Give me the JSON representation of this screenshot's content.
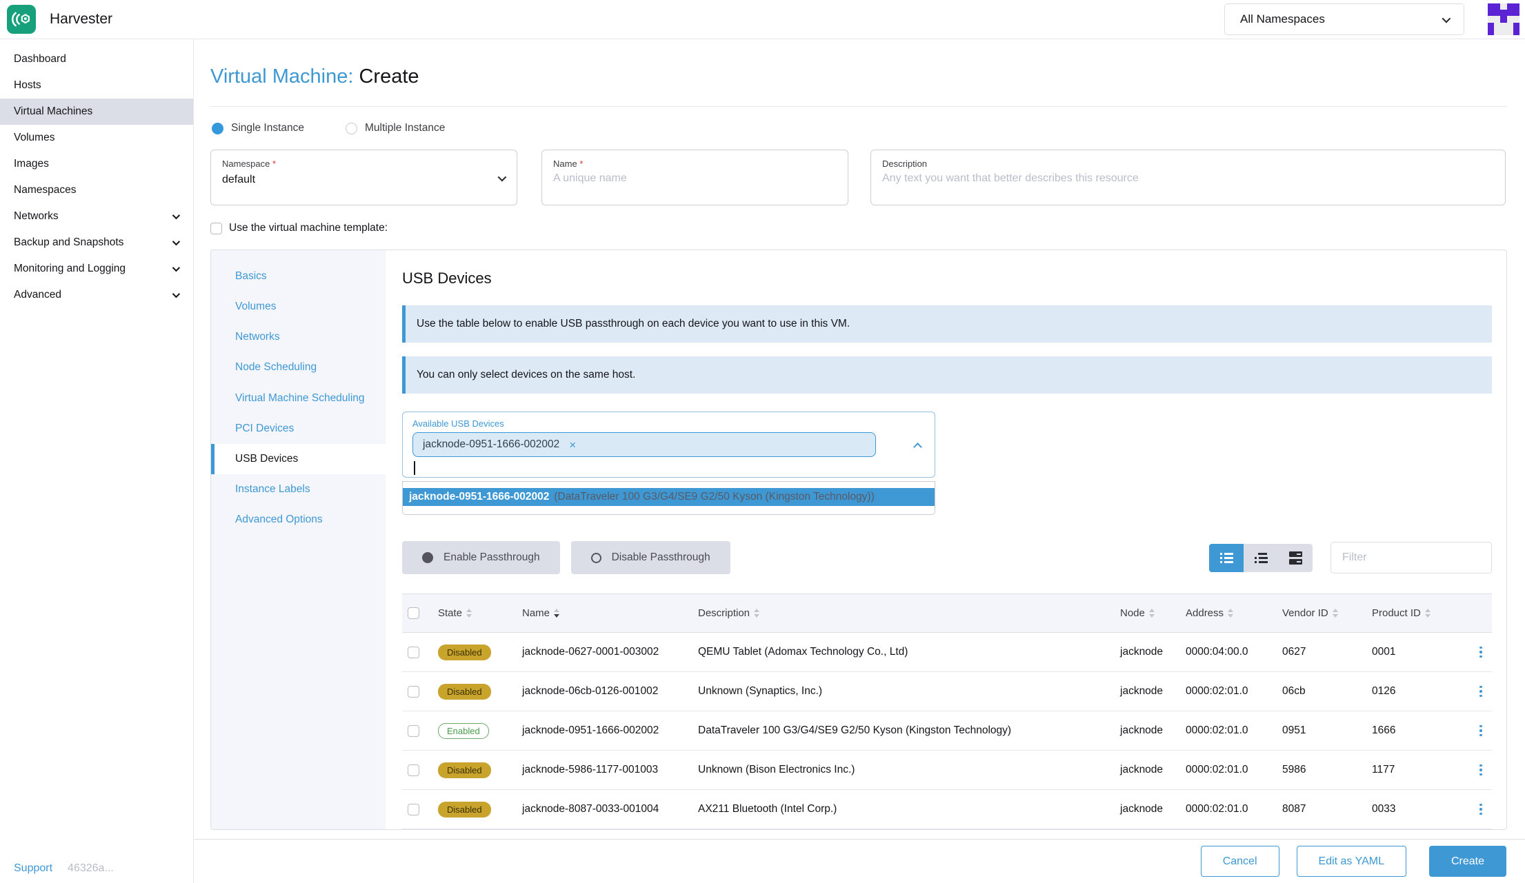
{
  "colors": {
    "primary": "#3d98d3",
    "banner_bg": "#ddeaf5",
    "warning_badge": "#c9a42d",
    "success_green": "#4b9a4b",
    "sidebar_selected": "#dcdee7",
    "avatar_purple": "#5c23d4",
    "logo_green": "#16a17c"
  },
  "header": {
    "brand": "Harvester",
    "namespace_filter": "All Namespaces",
    "avatar_pattern": [
      "11011",
      "11111",
      "00100",
      "10001",
      "10001"
    ]
  },
  "sidebar": {
    "items": [
      {
        "label": "Dashboard"
      },
      {
        "label": "Hosts"
      },
      {
        "label": "Virtual Machines"
      },
      {
        "label": "Volumes"
      },
      {
        "label": "Images"
      },
      {
        "label": "Namespaces"
      },
      {
        "label": "Networks"
      },
      {
        "label": "Backup and Snapshots"
      },
      {
        "label": "Monitoring and Logging"
      },
      {
        "label": "Advanced"
      }
    ],
    "active_item": "Virtual Machines",
    "support_label": "Support",
    "version": "46326a..."
  },
  "page": {
    "title_resource": "Virtual Machine:",
    "title_action": "Create",
    "instance_modes": {
      "single": "Single Instance",
      "multiple": "Multiple Instance",
      "selected": "Single Instance"
    }
  },
  "form": {
    "namespace": {
      "label": "Namespace",
      "required_mark": "*",
      "value": "default"
    },
    "name": {
      "label": "Name",
      "required_mark": "*",
      "placeholder": "A unique name"
    },
    "description": {
      "label": "Description",
      "placeholder": "Any text you want that better describes this resource"
    },
    "template_checkbox_label": "Use the virtual machine template:"
  },
  "tabs": {
    "items": [
      {
        "label": "Basics"
      },
      {
        "label": "Volumes"
      },
      {
        "label": "Networks"
      },
      {
        "label": "Node Scheduling"
      },
      {
        "label": "Virtual Machine Scheduling"
      },
      {
        "label": "PCI Devices"
      },
      {
        "label": "USB Devices"
      },
      {
        "label": "Instance Labels"
      },
      {
        "label": "Advanced Options"
      }
    ],
    "active_tab": "USB Devices"
  },
  "usb": {
    "heading": "USB Devices",
    "banners": [
      "Use the table below to enable USB passthrough on each device you want to use in this VM.",
      "You can only select devices on the same host."
    ],
    "picker": {
      "label": "Available USB Devices",
      "selected_tag": "jacknode-0951-1666-002002",
      "remove_mark": "×",
      "option": {
        "name": "jacknode-0951-1666-002002",
        "description": "(DataTraveler 100 G3/G4/SE9 G2/50 Kyson (Kingston Technology))"
      }
    },
    "actions": {
      "enable": "Enable Passthrough",
      "disable": "Disable Passthrough"
    },
    "filter_placeholder": "Filter",
    "table": {
      "columns": [
        "State",
        "Name",
        "Description",
        "Node",
        "Address",
        "Vendor ID",
        "Product ID"
      ],
      "sorted_column": "Name",
      "rows": [
        {
          "state": "Disabled",
          "name": "jacknode-0627-0001-003002",
          "description": "QEMU Tablet (Adomax Technology Co., Ltd)",
          "node": "jacknode",
          "address": "0000:04:00.0",
          "vendor_id": "0627",
          "product_id": "0001"
        },
        {
          "state": "Disabled",
          "name": "jacknode-06cb-0126-001002",
          "description": "Unknown (Synaptics, Inc.)",
          "node": "jacknode",
          "address": "0000:02:01.0",
          "vendor_id": "06cb",
          "product_id": "0126"
        },
        {
          "state": "Enabled",
          "name": "jacknode-0951-1666-002002",
          "description": "DataTraveler 100 G3/G4/SE9 G2/50 Kyson (Kingston Technology)",
          "node": "jacknode",
          "address": "0000:02:01.0",
          "vendor_id": "0951",
          "product_id": "1666"
        },
        {
          "state": "Disabled",
          "name": "jacknode-5986-1177-001003",
          "description": "Unknown (Bison Electronics Inc.)",
          "node": "jacknode",
          "address": "0000:02:01.0",
          "vendor_id": "5986",
          "product_id": "1177"
        },
        {
          "state": "Disabled",
          "name": "jacknode-8087-0033-001004",
          "description": "AX211 Bluetooth (Intel Corp.)",
          "node": "jacknode",
          "address": "0000:02:01.0",
          "vendor_id": "8087",
          "product_id": "0033"
        }
      ]
    }
  },
  "footer": {
    "cancel": "Cancel",
    "edit_yaml": "Edit as YAML",
    "create": "Create"
  }
}
